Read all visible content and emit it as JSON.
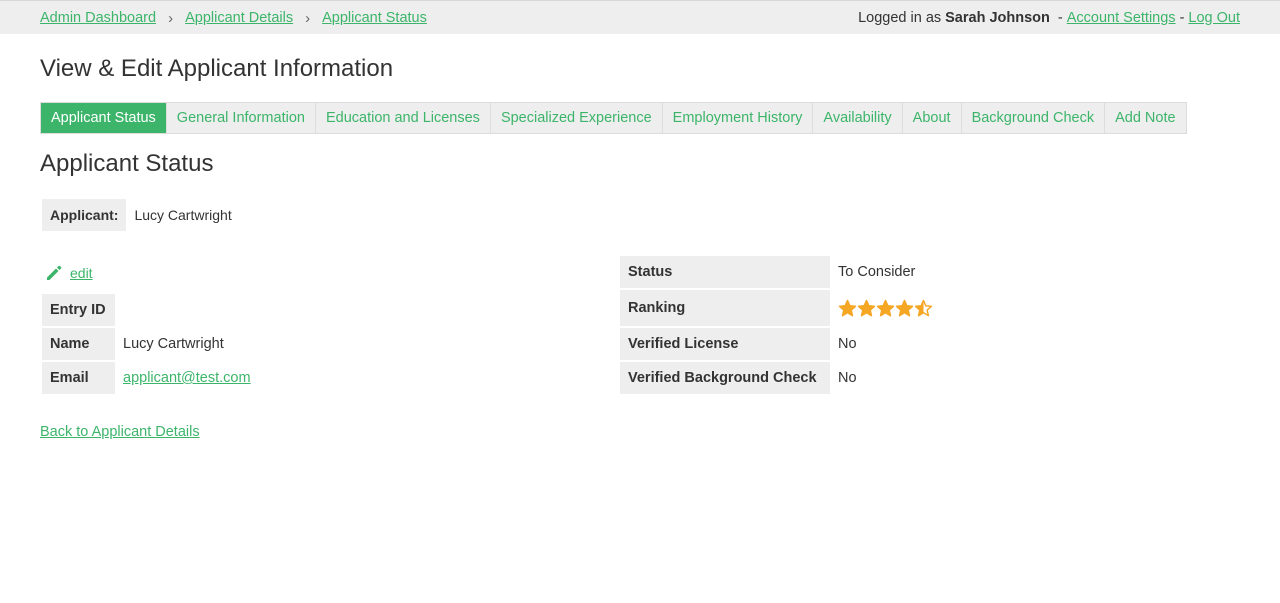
{
  "breadcrumb": {
    "items": [
      "Admin Dashboard",
      "Applicant Details",
      "Applicant Status"
    ],
    "separator": "›"
  },
  "session": {
    "prefix": "Logged in as",
    "user": "Sarah Johnson",
    "dash": "-",
    "account_settings": "Account Settings",
    "log_out": "Log Out"
  },
  "page_title": "View & Edit Applicant Information",
  "tabs": [
    {
      "label": "Applicant Status",
      "active": true
    },
    {
      "label": "General Information",
      "active": false
    },
    {
      "label": "Education and Licenses",
      "active": false
    },
    {
      "label": "Specialized Experience",
      "active": false
    },
    {
      "label": "Employment History",
      "active": false
    },
    {
      "label": "Availability",
      "active": false
    },
    {
      "label": "About",
      "active": false
    },
    {
      "label": "Background Check",
      "active": false
    },
    {
      "label": "Add Note",
      "active": false
    }
  ],
  "section_title": "Applicant Status",
  "applicant": {
    "label": "Applicant:",
    "value": "Lucy Cartwright"
  },
  "edit_label": "edit",
  "left_table": {
    "entry_id": {
      "label": "Entry ID",
      "value": ""
    },
    "name": {
      "label": "Name",
      "value": "Lucy Cartwright"
    },
    "email": {
      "label": "Email",
      "value": "applicant@test.com"
    }
  },
  "right_table": {
    "status": {
      "label": "Status",
      "value": "To Consider"
    },
    "ranking": {
      "label": "Ranking",
      "value": 4.5,
      "max": 5
    },
    "verified_license": {
      "label": "Verified License",
      "value": "No"
    },
    "verified_background": {
      "label": "Verified Background Check",
      "value": "No"
    }
  },
  "back_link": "Back to Applicant Details",
  "colors": {
    "accent": "#3cb56a",
    "star": "#f5a623",
    "panel": "#eeeeee"
  },
  "icons": {
    "edit": "pencil-icon",
    "ranking": "star-icon"
  }
}
